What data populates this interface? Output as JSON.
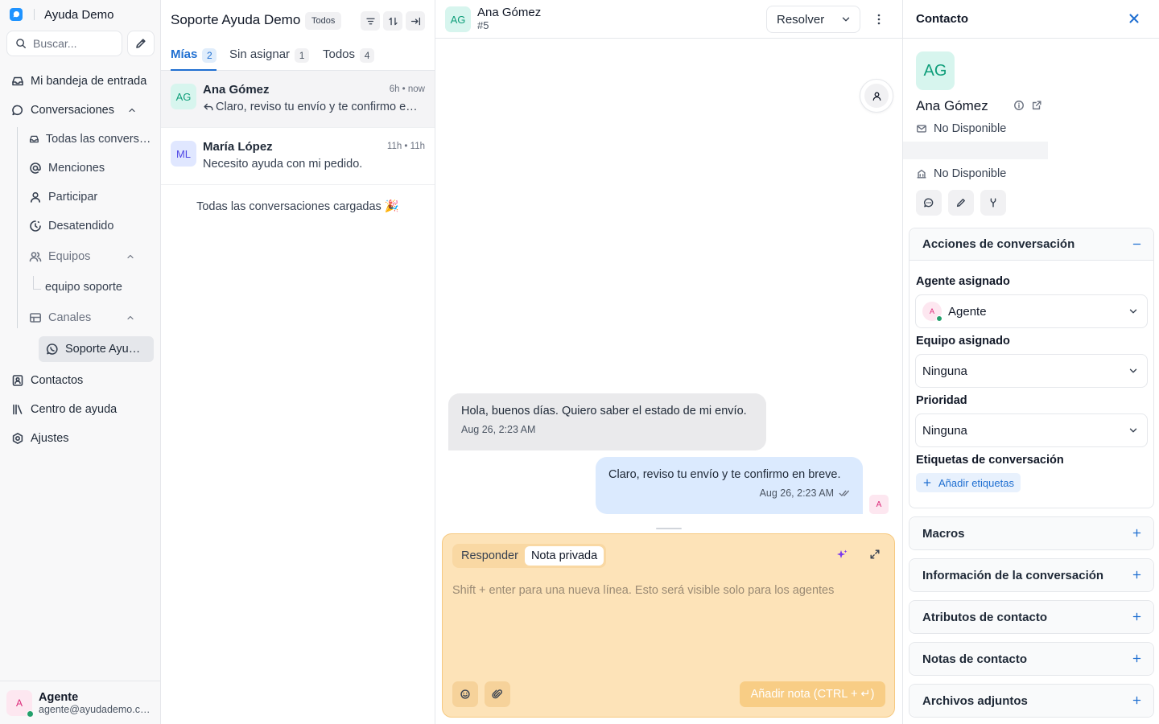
{
  "sidebar": {
    "brand": "Ayuda Demo",
    "search_placeholder": "Buscar...",
    "nav": {
      "inbox": "Mi bandeja de entrada",
      "conversations": "Conversaciones",
      "all_conversations": "Todas las conversaciones",
      "mentions": "Menciones",
      "participate": "Participar",
      "unattended": "Desatendido",
      "teams": "Equipos",
      "team_support": "equipo soporte",
      "channels": "Canales",
      "channel_inbox": "Soporte Ayuda Demo",
      "contacts": "Contactos",
      "help_center": "Centro de ayuda",
      "settings": "Ajustes"
    },
    "profile": {
      "initial": "A",
      "name": "Agente",
      "email": "agente@ayudademo.com"
    }
  },
  "conversation_list": {
    "title": "Soporte Ayuda Demo",
    "filter_badge": "Todos",
    "tabs": [
      {
        "label": "Mías",
        "count": "2"
      },
      {
        "label": "Sin asignar",
        "count": "1"
      },
      {
        "label": "Todos",
        "count": "4"
      }
    ],
    "items": [
      {
        "initials": "AG",
        "name": "Ana Gómez",
        "time": "6h • now",
        "message": "Claro, reviso tu envío y te confirmo en breve."
      },
      {
        "initials": "ML",
        "name": "María López",
        "time": "11h • 11h",
        "message": "Necesito ayuda con mi pedido."
      }
    ],
    "all_loaded": "Todas las conversaciones cargadas 🎉"
  },
  "chat": {
    "contact_initials": "AG",
    "contact_name": "Ana Gómez",
    "conversation_id": "#5",
    "resolve_label": "Resolver",
    "messages": [
      {
        "text": "Hola, buenos días. Quiero saber el estado de mi envío.",
        "time": "Aug 26, 2:23 AM"
      },
      {
        "text": "Claro, reviso tu envío y te confirmo en breve.",
        "time": "Aug 26, 2:23 AM",
        "agent_initial": "A"
      }
    ],
    "composer": {
      "reply_label": "Responder",
      "private_note_label": "Nota privada",
      "placeholder": "Shift + enter para una nueva línea. Esto será visible solo para los agentes",
      "send_label": "Añadir nota (CTRL + ↵)"
    }
  },
  "contact_panel": {
    "title": "Contacto",
    "initials": "AG",
    "name": "Ana Gómez",
    "email": "No Disponible",
    "company": "No Disponible",
    "sections": {
      "actions": "Acciones de conversación",
      "macros": "Macros",
      "conversation_info": "Información de la conversación",
      "contact_attributes": "Atributos de contacto",
      "contact_notes": "Notas de contacto",
      "attachments": "Archivos adjuntos"
    },
    "fields": {
      "assigned_agent_label": "Agente asignado",
      "assigned_agent_initial": "A",
      "assigned_agent_value": "Agente",
      "assigned_team_label": "Equipo asignado",
      "assigned_team_value": "Ninguna",
      "priority_label": "Prioridad",
      "priority_value": "Ninguna",
      "tags_label": "Etiquetas de conversación",
      "add_tags": "Añadir etiquetas"
    }
  }
}
